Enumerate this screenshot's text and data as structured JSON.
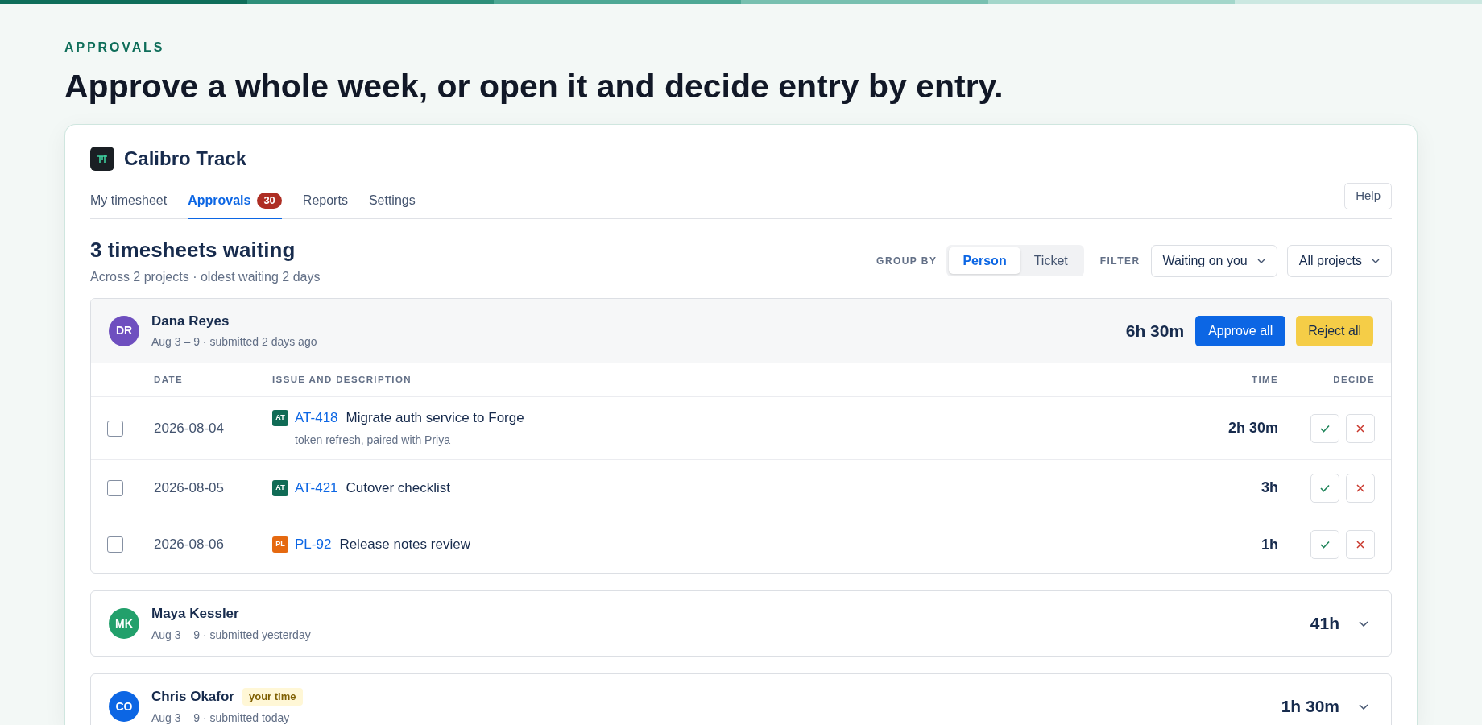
{
  "eyebrow": "APPROVALS",
  "headline": "Approve a whole week, or open it and decide entry by entry.",
  "app": {
    "name": "Calibro Track"
  },
  "tabs": [
    {
      "label": "My timesheet",
      "selected": false
    },
    {
      "label": "Approvals",
      "selected": true,
      "badge": "30"
    },
    {
      "label": "Reports",
      "selected": false
    },
    {
      "label": "Settings",
      "selected": false
    }
  ],
  "help_button": "Help",
  "summary": {
    "title": "3 timesheets waiting",
    "subtitle": "Across 2 projects · oldest waiting 2 days"
  },
  "group_by": {
    "label": "GROUP BY",
    "options": [
      {
        "label": "Person",
        "selected": true
      },
      {
        "label": "Ticket",
        "selected": false
      }
    ]
  },
  "filter": {
    "label": "FILTER",
    "dropdowns": [
      "Waiting on you",
      "All projects"
    ]
  },
  "columns": [
    "DATE",
    "ISSUE AND DESCRIPTION",
    "TIME",
    "DECIDE"
  ],
  "groups": [
    {
      "initials": "DR",
      "color": "#6e4fbf",
      "name": "Dana Reyes",
      "meta": "Aug 3 – 9 · submitted 2 days ago",
      "total": "6h 30m",
      "expanded": true,
      "approve_label": "Approve all",
      "reject_label": "Reject all",
      "entries": [
        {
          "checked": false,
          "date": "2026-08-04",
          "project": "AT",
          "color": "#106b55",
          "issue": "AT-418",
          "title": "Migrate auth service to Forge",
          "note": "token refresh, paired with Priya",
          "time": "2h 30m"
        },
        {
          "checked": false,
          "date": "2026-08-05",
          "project": "AT",
          "color": "#106b55",
          "issue": "AT-421",
          "title": "Cutover checklist",
          "time": "3h"
        },
        {
          "checked": false,
          "date": "2026-08-06",
          "project": "PL",
          "color": "#e56910",
          "issue": "PL-92",
          "title": "Release notes review",
          "time": "1h"
        }
      ]
    },
    {
      "initials": "MK",
      "color": "#22a06b",
      "name": "Maya Kessler",
      "meta": "Aug 3 – 9 · submitted yesterday",
      "total": "41h",
      "expanded": false
    },
    {
      "initials": "CO",
      "color": "#0c66e4",
      "name": "Chris Okafor",
      "tag": "your time",
      "meta": "Aug 3 – 9 · submitted today",
      "total": "1h 30m",
      "expanded": false
    }
  ]
}
